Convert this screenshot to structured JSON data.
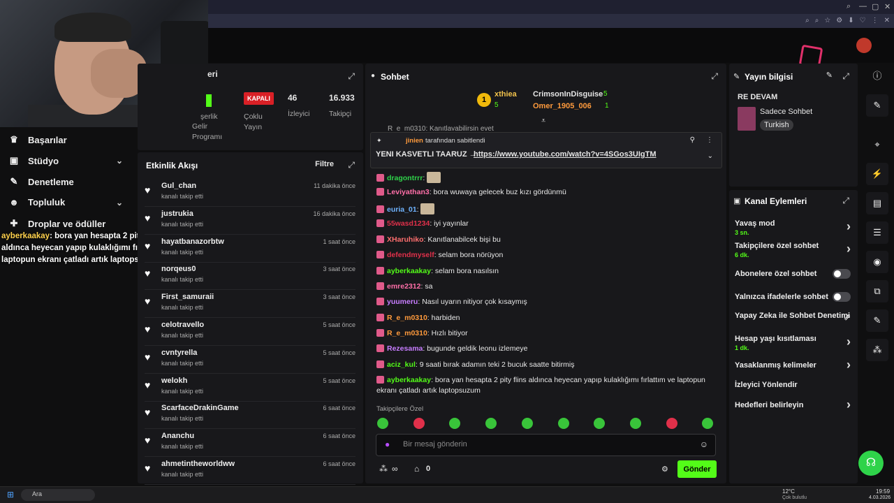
{
  "browser": {
    "controls": [
      "⌕",
      "—",
      "▢",
      "✕"
    ]
  },
  "stats": {
    "partial_title": "eri",
    "program_label": [
      "Gelir",
      "Programı"
    ],
    "program_partial": "şerlik",
    "closed_badge": "KAPALI",
    "multi_stream_label": [
      "Çoklu",
      "Yayın"
    ],
    "viewers_value": "46",
    "viewers_label": "İzleyici",
    "followers_value": "16.933",
    "followers_label": "Takipçi"
  },
  "nav": [
    {
      "label": "Başarılar",
      "icon": "trophy-icon"
    },
    {
      "label": "Stüdyo",
      "icon": "studio-icon",
      "chevron": true
    },
    {
      "label": "Denetleme",
      "icon": "wrench-icon"
    },
    {
      "label": "Topluluk",
      "icon": "people-icon",
      "chevron": true
    },
    {
      "label": "Droplar ve ödüller",
      "icon": "gift-icon"
    }
  ],
  "overlay": {
    "user": "ayberkaakay",
    "text": ": bora yan hesapta 2 pity flins aldınca heyecan yapıp kulaklığımı fırlattım ve laptopun ekranı çatladı artık laptopsuzum"
  },
  "activity": {
    "title": "Etkinlik Akışı",
    "filter": "Filtre",
    "rows": [
      {
        "name": "Gul_chan",
        "sub": "kanalı takip etti",
        "time": "11 dakika önce"
      },
      {
        "name": "justrukia",
        "sub": "kanalı takip etti",
        "time": "16 dakika önce"
      },
      {
        "name": "hayatbanazorbtw",
        "sub": "kanalı takip etti",
        "time": "1 saat önce"
      },
      {
        "name": "norqeus0",
        "sub": "kanalı takip etti",
        "time": "3 saat önce"
      },
      {
        "name": "First_samuraii",
        "sub": "kanalı takip etti",
        "time": "3 saat önce"
      },
      {
        "name": "celotravello",
        "sub": "kanalı takip etti",
        "time": "5 saat önce"
      },
      {
        "name": "cvntyrella",
        "sub": "kanalı takip etti",
        "time": "5 saat önce"
      },
      {
        "name": "welokh",
        "sub": "kanalı takip etti",
        "time": "5 saat önce"
      },
      {
        "name": "ScarfaceDrakinGame",
        "sub": "kanalı takip etti",
        "time": "6 saat önce"
      },
      {
        "name": "Ananchu",
        "sub": "kanalı takip etti",
        "time": "6 saat önce"
      },
      {
        "name": "ahmetintheworldww",
        "sub": "kanalı takip etti",
        "time": "6 saat önce"
      }
    ]
  },
  "chat": {
    "title": "Sohbet",
    "leaderboard": {
      "first_rank": "1",
      "first_name": "xthiea",
      "first_count": "5",
      "second_name": "CrimsonInDisguise",
      "second_count": "5",
      "third_name": "Omer_1905_006",
      "third_count": "1"
    },
    "pinned": {
      "by_user": "jinien",
      "by_text": "tarafından sabitlendi",
      "text": "YENI KASVETLI TAARUZ →",
      "link": "https://www.youtube.com/watch?v=4SGos3UIgTM"
    },
    "partial_top": "R_e_m0310: Kanıtlayabilirsin evet",
    "messages": [
      {
        "user": "dragontrrr",
        "color": "#2fd34a",
        "text": ""
      },
      {
        "user": "Leviyathan3",
        "color": "#ff6fa8",
        "text": "bora wuwaya gelecek buz kızı gördünmü"
      },
      {
        "user": "euria_01",
        "color": "#6fb3ff",
        "text": ""
      },
      {
        "user": "55wasd1234",
        "color": "#e0304a",
        "text": "iyi yayınlar"
      },
      {
        "user": "XHaruhiko",
        "color": "#ff6f6f",
        "text": "Kanıtlanabilcek bişi bu"
      },
      {
        "user": "defendmyself",
        "color": "#e0304a",
        "text": "selam bora nörüyon"
      },
      {
        "user": "ayberkaakay",
        "color": "#53fc18",
        "text": "selam bora nasılsın"
      },
      {
        "user": "emre2312",
        "color": "#ff6fa8",
        "text": "sa"
      },
      {
        "user": "yuumeru",
        "color": "#c77dff",
        "text": "Nasıl uyarın nitiyor çok kısaymış"
      },
      {
        "user": "R_e_m0310",
        "color": "#ff9a3c",
        "text": "harbiden"
      },
      {
        "user": "R_e_m0310",
        "color": "#ff9a3c",
        "text": "Hızlı bitiyor"
      },
      {
        "user": "Rezesama",
        "color": "#c77dff",
        "text": "bugunde geldik leonu izlemeye"
      },
      {
        "user": "aciz_kul",
        "color": "#53fc18",
        "text": "9 saati bırak adamın teki 2 bucuk saatte bitirmiş"
      },
      {
        "user": "ayberkaakay",
        "color": "#53fc18",
        "text": "bora yan hesapta 2 pity flins aldınca heyecan yapıp kulaklığımı fırlattım ve laptopun ekranı çatladı artık laptopsuzum"
      }
    ],
    "followers_only": "Takipçilere Özel",
    "input_placeholder": "Bir mesaj gönderin",
    "points": "∞",
    "chest_count": "0",
    "send": "Gönder"
  },
  "info": {
    "title": "Yayın bilgisi",
    "stream_title": "RE DEVAM",
    "category": "Sadece Sohbet",
    "language": "Turkish"
  },
  "actions": {
    "title": "Kanal Eylemleri",
    "items": [
      {
        "label": "Yavaş mod",
        "value": "3 sn.",
        "type": "chevron"
      },
      {
        "label": "Takipçilere özel sohbet",
        "value": "6 dk.",
        "type": "chevron"
      },
      {
        "label": "Abonelere özel sohbet",
        "value": "",
        "type": "toggle"
      },
      {
        "label": "Yalnızca ifadelerle sohbet",
        "value": "",
        "type": "toggle"
      },
      {
        "label": "Yapay Zeka ile Sohbet Denetimi",
        "value": "",
        "type": "external"
      },
      {
        "label": "Hesap yaşı kısıtlaması",
        "value": "1 dk.",
        "type": "chevron"
      },
      {
        "label": "Yasaklanmış kelimeler",
        "value": "",
        "type": "chevron"
      },
      {
        "label": "İzleyici Yönlendir",
        "value": "",
        "type": "none"
      },
      {
        "label": "Hedefleri belirleyin",
        "value": "",
        "type": "chevron"
      }
    ]
  },
  "taskbar": {
    "search": "Ara",
    "weather": "12°C",
    "weather_desc": "Çok bulutlu",
    "time": "19:59",
    "date": "4.03.2026"
  },
  "colors": {
    "accent": "#53fc18",
    "panel": "#18181b",
    "bg": "#0f0f10"
  }
}
